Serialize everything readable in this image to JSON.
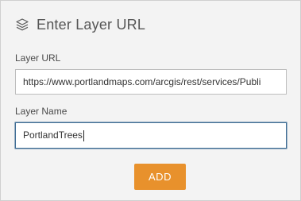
{
  "dialog": {
    "title": "Enter Layer URL",
    "title_icon": "layers-icon"
  },
  "layer_url": {
    "label": "Layer URL",
    "value": "https://www.portlandmaps.com/arcgis/rest/services/Publi"
  },
  "layer_name": {
    "label": "Layer Name",
    "value": "PortlandTrees"
  },
  "add_button": {
    "label": "ADD"
  },
  "colors": {
    "panel_background": "#f3f3f3",
    "accent_button": "#e8912c",
    "focused_border": "#3f6d94"
  }
}
